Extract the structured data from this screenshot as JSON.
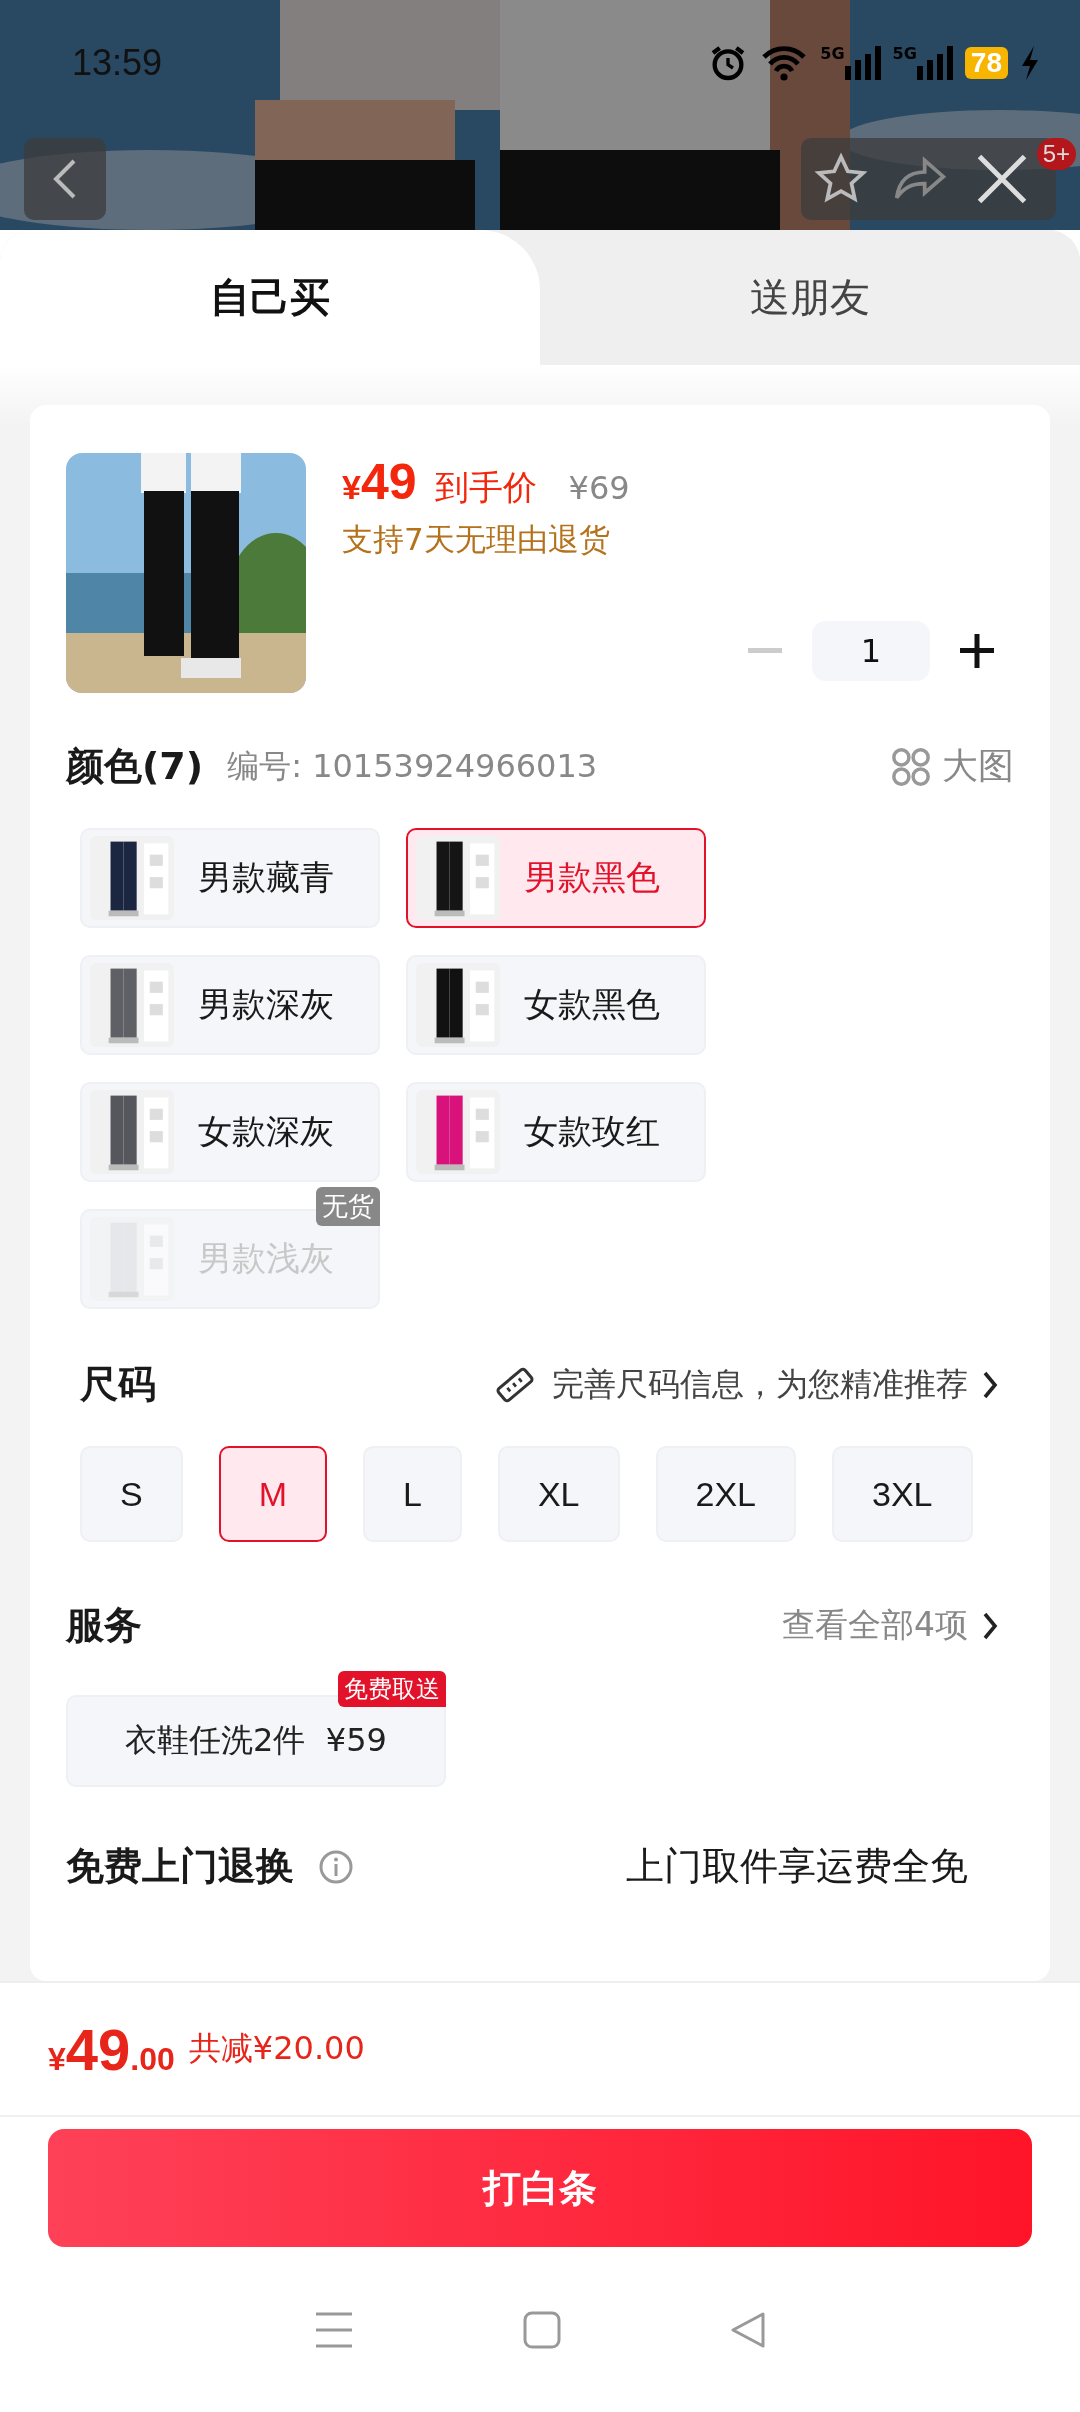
{
  "status_bar": {
    "time": "13:59",
    "signals": [
      "5G",
      "5G"
    ],
    "battery": "78"
  },
  "top_actions": {
    "badge": "5+"
  },
  "tabs": [
    {
      "label": "自己买",
      "selected": true
    },
    {
      "label": "送朋友",
      "selected": false
    }
  ],
  "product": {
    "currency": "¥",
    "price": "49",
    "price_label": "到手价",
    "original_price": "¥69",
    "return_policy": "支持7天无理由退货",
    "quantity": "1"
  },
  "color_section": {
    "title": "颜色(7)",
    "code": "编号: 10153924966013",
    "gallery_label": "大图",
    "options": [
      {
        "label": "男款藏青",
        "selected": false,
        "sold_out": false
      },
      {
        "label": "男款黑色",
        "selected": true,
        "sold_out": false
      },
      {
        "label": "男款深灰",
        "selected": false,
        "sold_out": false
      },
      {
        "label": "女款黑色",
        "selected": false,
        "sold_out": false
      },
      {
        "label": "女款深灰",
        "selected": false,
        "sold_out": false
      },
      {
        "label": "女款玫红",
        "selected": false,
        "sold_out": false
      },
      {
        "label": "男款浅灰",
        "selected": false,
        "sold_out": true,
        "badge": "无货"
      }
    ]
  },
  "size_section": {
    "title": "尺码",
    "hint": "完善尺码信息，为您精准推荐",
    "options": [
      {
        "label": "S",
        "selected": false
      },
      {
        "label": "M",
        "selected": true
      },
      {
        "label": "L",
        "selected": false
      },
      {
        "label": "XL",
        "selected": false
      },
      {
        "label": "2XL",
        "selected": false
      },
      {
        "label": "3XL",
        "selected": false
      }
    ]
  },
  "services": {
    "title": "服务",
    "link": "查看全部4项",
    "items": [
      {
        "label": "衣鞋任洗2件  ¥59",
        "badge": "免费取送"
      }
    ]
  },
  "return_service": {
    "title": "免费上门退换",
    "note": "上门取件享运费全免"
  },
  "bottom_bar": {
    "currency": "¥",
    "amount": "49",
    "decimals": ".00",
    "discount": "共减¥20.00",
    "button": "打白条"
  }
}
